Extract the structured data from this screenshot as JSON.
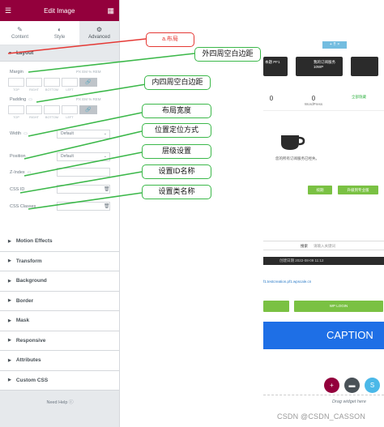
{
  "panel": {
    "title": "Edit Image",
    "tabs": [
      {
        "label": "Content",
        "icon": "pencil-icon"
      },
      {
        "label": "Style",
        "icon": "half-circle-icon"
      },
      {
        "label": "Advanced",
        "icon": "gear-icon"
      }
    ],
    "layout_section": "Layout",
    "margin_label": "Margin",
    "padding_label": "Padding",
    "units": "PX  EM  %  REM",
    "dim_labels": [
      "TOP",
      "RIGHT",
      "BOTTOM",
      "LEFT"
    ],
    "width_label": "Width",
    "width_value": "Default",
    "position_label": "Position",
    "position_value": "Default",
    "zindex_label": "Z-Index",
    "cssid_label": "CSS ID",
    "cssclasses_label": "CSS Classes",
    "sections": [
      "Motion Effects",
      "Transform",
      "Background",
      "Border",
      "Mask",
      "Responsive",
      "Attributes",
      "Custom CSS"
    ],
    "need_help": "Need Help"
  },
  "callouts": {
    "layout": "a.布局",
    "margin": "外四周空白边距",
    "padding": "内四周空白边距",
    "width": "布局宽度",
    "position": "位置定位方式",
    "zindex": "层级设置",
    "cssid": "设置ID名称",
    "cssclasses": "设置类名称"
  },
  "preview": {
    "topbar": "+ ⠿ ×",
    "card1": "本题 PF1",
    "card2_title": "我的订阅服务",
    "card2_sub": "10WP",
    "stat1_num": "0",
    "stat2_num": "0",
    "stat2_label": "WordPress",
    "stat3_label": "全部隐藏",
    "empty_text": "您的所有订阅服务已经失。",
    "btn_renew": "续期",
    "btn_upgrade": "升级到专业版",
    "search_label": "搜索",
    "search_placeholder": "请输入关键词",
    "date_text": "创建日期  2022-08-09 11:12",
    "url_text": "f1.testcreation.pf1.wpscale.cn",
    "wp_login": "WP LOGIN",
    "caption": "CAPTION",
    "drag_text": "Drag widget here"
  },
  "watermark": "CSDN @CSDN_CASSON",
  "colors": {
    "brand": "#93003c",
    "callout_green": "#3cb84a",
    "callout_red": "#e53935",
    "caption_blue": "#1e6fe6",
    "button_green": "#7ac143"
  }
}
